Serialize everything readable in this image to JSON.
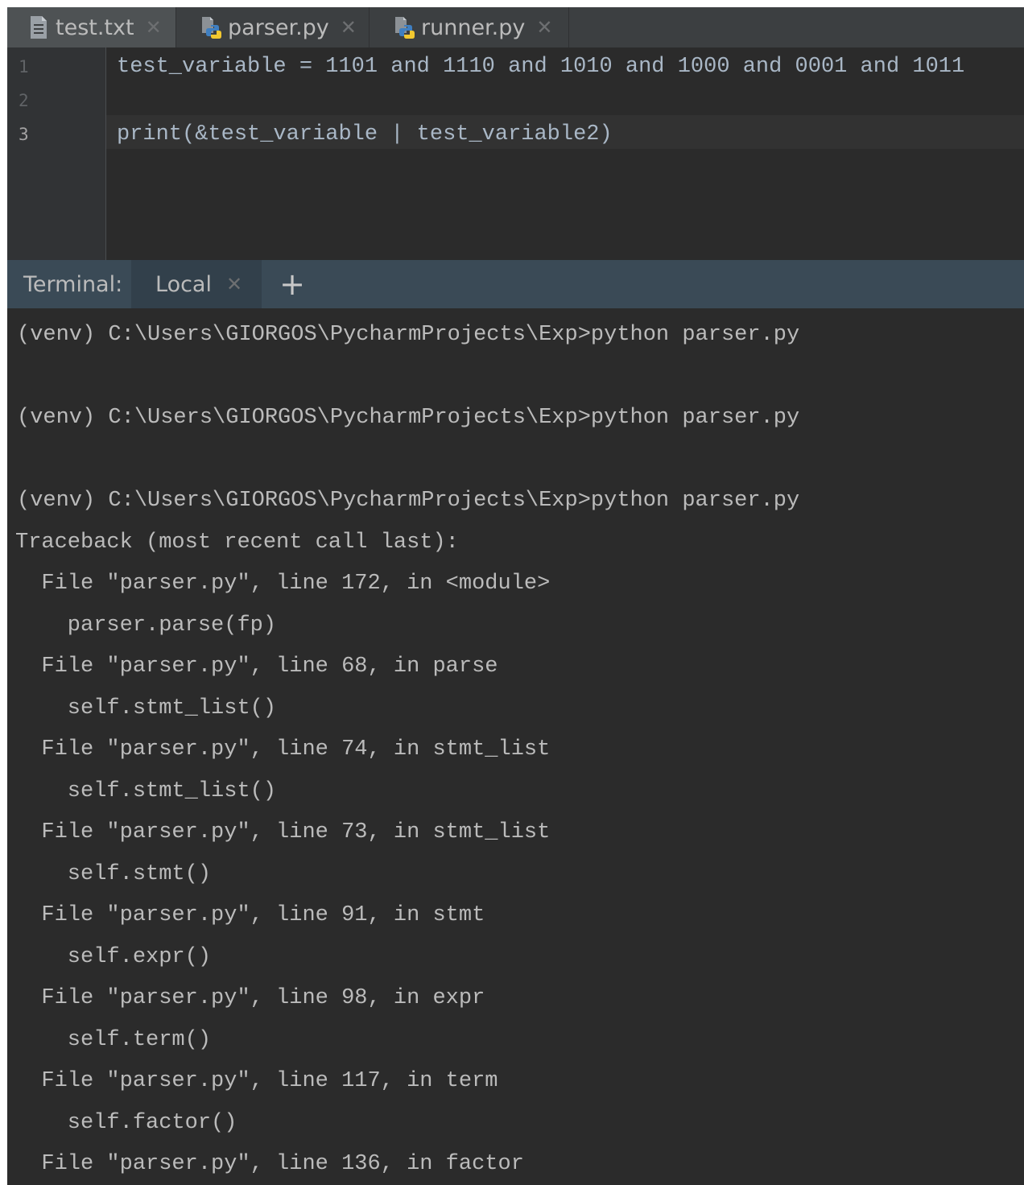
{
  "tabs": [
    {
      "label": "test.txt",
      "icon": "text-file-icon",
      "active": true
    },
    {
      "label": "parser.py",
      "icon": "python-file-icon",
      "active": false
    },
    {
      "label": "runner.py",
      "icon": "python-file-icon",
      "active": false
    }
  ],
  "editor": {
    "line_numbers": [
      "1",
      "2",
      "3"
    ],
    "lines": [
      "test_variable = 1101 and 1110 and 1010 and 1000 and 0001 and 1011",
      "",
      "print(&test_variable | test_variable2)"
    ]
  },
  "terminal": {
    "label": "Terminal:",
    "tab": "Local",
    "add": "+",
    "lines": [
      "(venv) C:\\Users\\GIORGOS\\PycharmProjects\\Exp>python parser.py",
      "",
      "(venv) C:\\Users\\GIORGOS\\PycharmProjects\\Exp>python parser.py",
      "",
      "(venv) C:\\Users\\GIORGOS\\PycharmProjects\\Exp>python parser.py",
      "Traceback (most recent call last):",
      "  File \"parser.py\", line 172, in <module>",
      "    parser.parse(fp)",
      "  File \"parser.py\", line 68, in parse",
      "    self.stmt_list()",
      "  File \"parser.py\", line 74, in stmt_list",
      "    self.stmt_list()",
      "  File \"parser.py\", line 73, in stmt_list",
      "    self.stmt()",
      "  File \"parser.py\", line 91, in stmt",
      "    self.expr()",
      "  File \"parser.py\", line 98, in expr",
      "    self.term()",
      "  File \"parser.py\", line 117, in term",
      "    self.factor()",
      "  File \"parser.py\", line 136, in factor"
    ]
  }
}
